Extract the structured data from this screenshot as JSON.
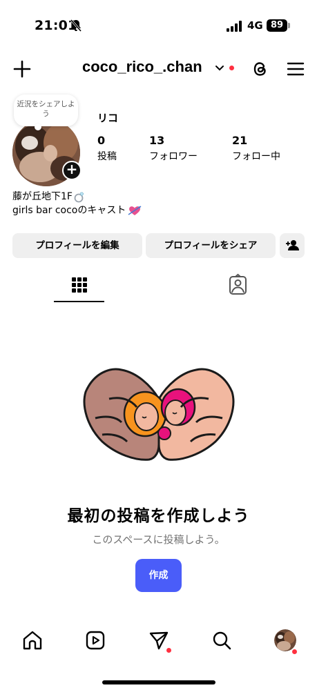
{
  "status_bar": {
    "time": "21:01",
    "network": "4G",
    "battery": "89"
  },
  "header": {
    "username": "coco_rico_.chan"
  },
  "profile": {
    "note": "近況をシェアしよう",
    "display_name": "リコ",
    "stats": [
      {
        "value": "0",
        "label": "投稿"
      },
      {
        "value": "13",
        "label": "フォロワー"
      },
      {
        "value": "21",
        "label": "フォロー中"
      }
    ],
    "bio": [
      "藤が丘地下1F",
      "girls bar cocoのキャスト"
    ]
  },
  "buttons": {
    "edit": "プロフィールを編集",
    "share": "プロフィールをシェア"
  },
  "empty_state": {
    "title": "最初の投稿を作成しよう",
    "subtitle": "このスペースに投稿しよう。",
    "create": "作成"
  },
  "icons": {
    "header": [
      "plus-icon",
      "chevron-down-icon",
      "threads-icon",
      "menu-icon"
    ],
    "tabs": [
      "grid-icon",
      "tagged-icon"
    ],
    "nav": [
      "home-icon",
      "reels-icon",
      "send-icon",
      "search-icon",
      "profile-avatar"
    ]
  },
  "colors": {
    "accent": "#4a5df9",
    "notification": "#ff3040",
    "pill": "#efefef"
  }
}
